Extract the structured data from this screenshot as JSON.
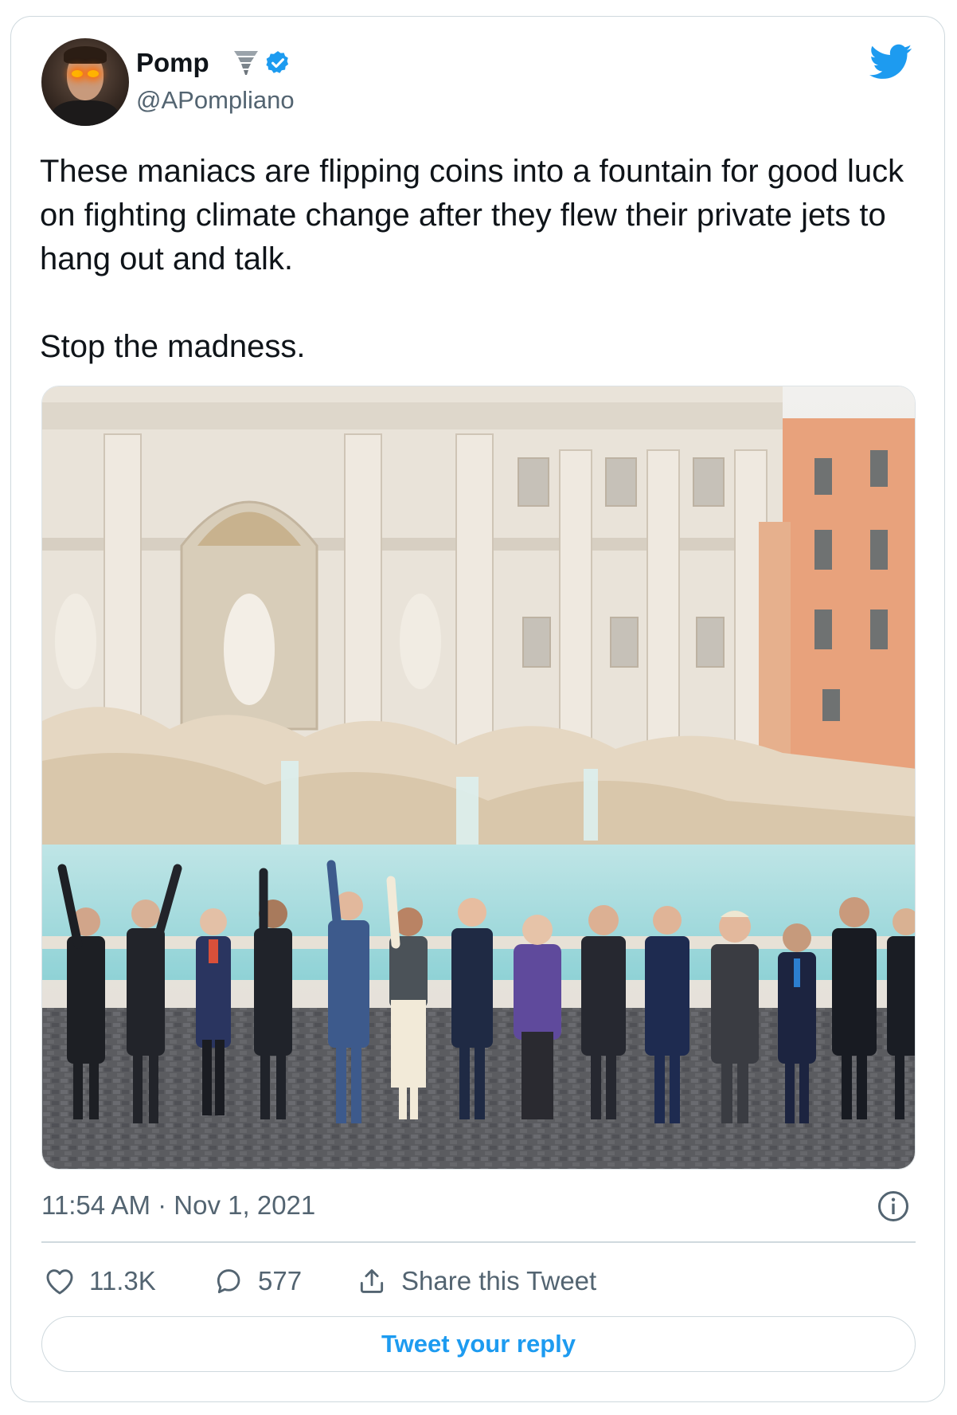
{
  "author": {
    "name": "Pomp",
    "handle": "@APompliano",
    "avatar_icon": "profile-photo-laser-eyes",
    "badge_icons": [
      "tornado-emoji-icon",
      "verified-badge-icon"
    ]
  },
  "brand": {
    "logo_icon": "twitter-bird-icon",
    "accent_color": "#1d9bf0"
  },
  "tweet": {
    "text": "These maniacs are flipping coins into a fountain for good luck on fighting climate change after they flew their private jets to hang out and talk.\n\nStop the madness.",
    "timestamp": "11:54 AM · Nov 1, 2021"
  },
  "actions": {
    "likes": "11.3K",
    "replies": "577",
    "share_label": "Share this Tweet"
  },
  "reply_button": {
    "label": "Tweet your reply"
  },
  "colors": {
    "text": "#0f1419",
    "secondary": "#536471",
    "border": "#cfd9de"
  }
}
